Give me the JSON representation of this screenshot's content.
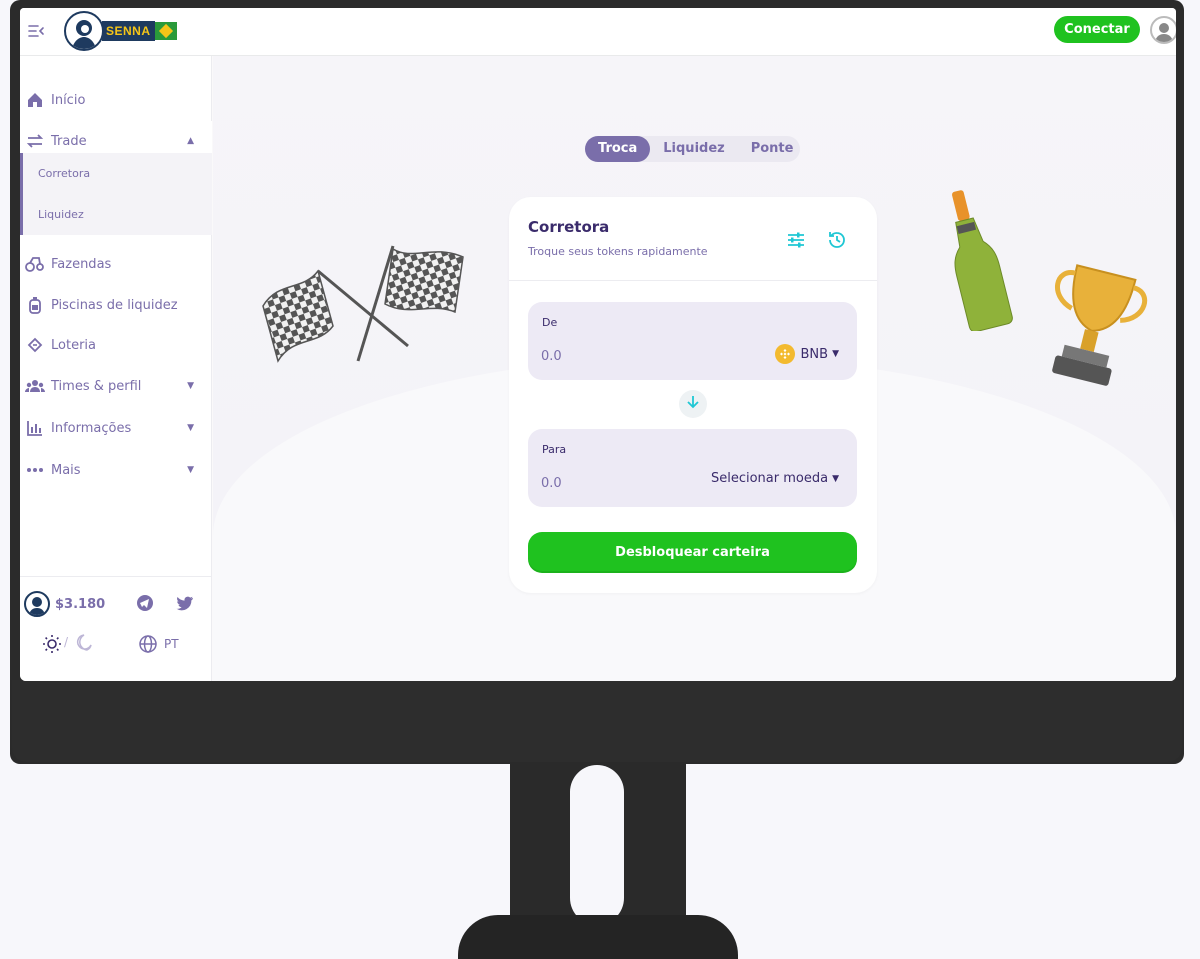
{
  "topbar": {
    "logo_text": "SENNA",
    "connect_label": "Conectar"
  },
  "sidebar": {
    "items": [
      {
        "label": "Início"
      },
      {
        "label": "Trade"
      },
      {
        "label": "Fazendas"
      },
      {
        "label": "Piscinas de liquidez"
      },
      {
        "label": "Loteria"
      },
      {
        "label": "Times & perfil"
      },
      {
        "label": "Informações"
      },
      {
        "label": "Mais"
      }
    ],
    "trade_sub": [
      "Corretora",
      "Liquidez"
    ],
    "footer": {
      "price": "$3.180",
      "separator": "/",
      "language": "PT"
    }
  },
  "main": {
    "tabs": [
      "Troca",
      "Liquidez",
      "Ponte"
    ],
    "active_tab": "Troca",
    "card": {
      "title": "Corretora",
      "subtitle": "Troque seus tokens rapidamente",
      "from": {
        "label": "De",
        "value": "0.0",
        "token": "BNB"
      },
      "to": {
        "label": "Para",
        "value": "0.0",
        "token": "Selecionar moeda"
      },
      "unlock_label": "Desbloquear carteira"
    }
  },
  "colors": {
    "accent": "#7a6eaa",
    "primary_green": "#1fc21f",
    "title_text": "#3a2b6b",
    "teal_icon": "#1fc7d4",
    "bnb_yellow": "#f3ba2f"
  },
  "icons": [
    "menu-toggle-icon",
    "home-icon",
    "trade-icon",
    "farms-icon",
    "pools-icon",
    "lottery-icon",
    "teams-icon",
    "info-icon",
    "more-icon",
    "telegram-icon",
    "twitter-icon",
    "sun-icon",
    "moon-icon",
    "globe-icon",
    "settings-icon",
    "history-icon",
    "arrow-down-icon",
    "bnb-icon"
  ]
}
